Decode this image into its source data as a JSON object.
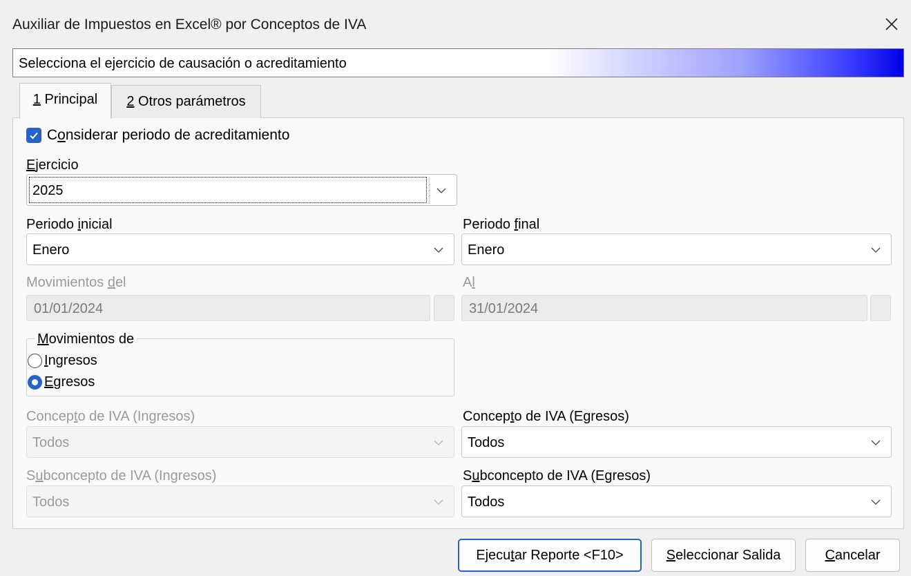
{
  "window": {
    "title": "Auxiliar de Impuestos en Excel® por Conceptos de IVA"
  },
  "banner": {
    "text": "Selecciona el ejercicio de causación o acreditamiento"
  },
  "tabs": [
    {
      "num": "1",
      "label": " Principal"
    },
    {
      "num": "2",
      "label": " Otros parámetros"
    }
  ],
  "principal": {
    "considerar": {
      "pre": "C",
      "ul": "o",
      "post": "nsiderar periodo de acreditamiento",
      "checked": true
    },
    "ejercicio": {
      "pre": "",
      "ul": "E",
      "post": "jercicio",
      "value": "2025"
    },
    "periodo_inicial": {
      "pre": "Periodo ",
      "ul": "i",
      "post": "nicial",
      "value": "Enero"
    },
    "periodo_final": {
      "pre": "Periodo ",
      "ul": "f",
      "post": "inal",
      "value": "Enero"
    },
    "movimientos_del": {
      "pre": "Movimientos ",
      "ul": "d",
      "post": "el",
      "value": "01/01/2024"
    },
    "al": {
      "pre": "A",
      "ul": "l",
      "post": "",
      "value": "31/01/2024"
    },
    "movimientos_de": {
      "pre": "",
      "ul": "M",
      "post": "ovimientos de",
      "options": [
        {
          "pre": "",
          "ul": "I",
          "post": "ngresos",
          "selected": false
        },
        {
          "pre": "",
          "ul": "E",
          "post": "gresos",
          "selected": true
        }
      ]
    },
    "concepto_ingresos": {
      "pre": "Concep",
      "ul": "t",
      "post": "o de IVA (Ingresos)",
      "value": "Todos"
    },
    "concepto_egresos": {
      "pre": "Concep",
      "ul": "t",
      "post": "o de IVA (Egresos)",
      "value": "Todos"
    },
    "subconcepto_ingresos": {
      "pre": "S",
      "ul": "u",
      "post": "bconcepto de IVA (Ingresos)",
      "value": "Todos"
    },
    "subconcepto_egresos": {
      "pre": "S",
      "ul": "u",
      "post": "bconcepto de IVA (Egresos)",
      "value": "Todos"
    }
  },
  "buttons": {
    "ejecutar": {
      "pre": "Ejecu",
      "ul": "t",
      "post": "ar Reporte <F10>"
    },
    "seleccionar": {
      "pre": "",
      "ul": "S",
      "post": "eleccionar Salida"
    },
    "cancelar": {
      "pre": "",
      "ul": "C",
      "post": "ancelar"
    }
  },
  "colors": {
    "accent": "#2563c9",
    "banner_end": "#0000e8",
    "disabled_text": "#9a9a9a"
  }
}
